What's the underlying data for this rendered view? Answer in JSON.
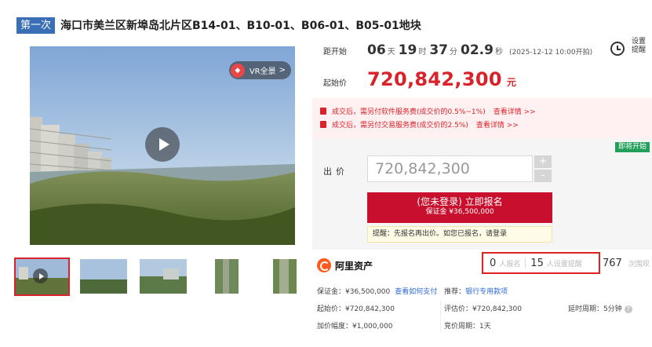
{
  "header": {
    "round_badge": "第一次",
    "title": "海口市美兰区新埠岛北片区B14-01、B10-01、B06-01、B05-01地块"
  },
  "media": {
    "vr_label": "VR全景",
    "vr_chevron": ">",
    "thumbnails_count": 5
  },
  "countdown": {
    "label": "距开始",
    "days": "06",
    "days_unit": "天",
    "hours": "19",
    "hours_unit": "时",
    "minutes": "37",
    "minutes_unit": "分",
    "seconds": "02.9",
    "seconds_unit": "秒",
    "start_note": "(2025-12-12 10:00开拍)"
  },
  "remind": {
    "label": "设置提醒"
  },
  "start_price": {
    "label": "起始价",
    "value": "720,842,300",
    "unit": "元"
  },
  "fees": [
    {
      "text": "成交后，需另付软件服务费(成交价的0.5%~1%)",
      "link": "查看详情 >>"
    },
    {
      "text": "成交后，需另付交易服务费(成交价的2.5%)",
      "link": "查看详情 >>"
    }
  ],
  "bid": {
    "status_tag": "即将开始",
    "label": "出价",
    "input_value": "720,842,300",
    "plus": "+",
    "minus": "-",
    "signup_main": "(您未登录) 立即报名",
    "signup_sub": "保证金 ¥36,500,000",
    "reminder": "提醒：先报名再出价。如您已报名，请登录"
  },
  "platform": {
    "name": "阿里资产",
    "signups": "0",
    "signups_label": "人报名",
    "reminders": "15",
    "reminders_label": "人设置提醒",
    "views": "767",
    "views_label": "次围观"
  },
  "details": {
    "deposit": "保证金：¥36,500,000",
    "pay_link": "查看如何支付",
    "recommend_label": "推荐：",
    "recommend_link": "银行专用款项",
    "start_price": "起始价：¥720,842,300",
    "appraisal": "评估价：¥720,842,300",
    "delay": "延时周期：5分钟",
    "help": "?",
    "increment": "加价幅度：¥1,000,000",
    "cycle": "竞价周期：1天"
  },
  "colors": {
    "accent": "#d8232a",
    "badge_blue": "#3a6fb5",
    "signup_red": "#c8102e",
    "status_green": "#22a05a",
    "link_blue": "#2e6ad8"
  }
}
